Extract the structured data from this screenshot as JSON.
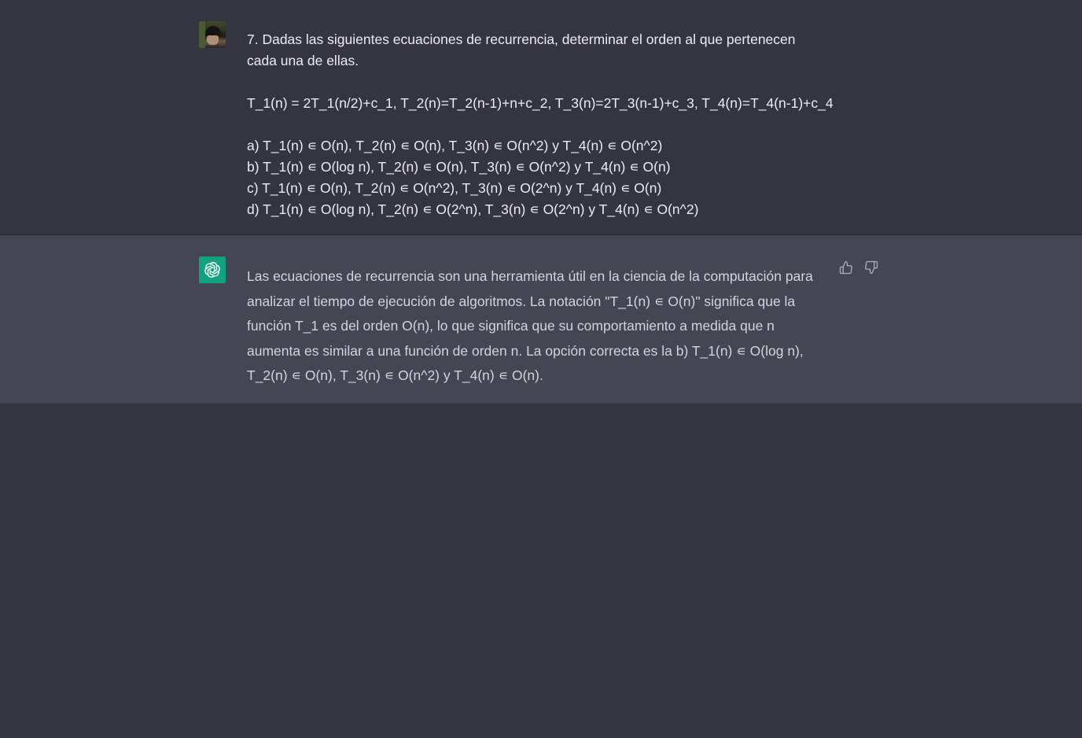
{
  "conversation": {
    "user_message": {
      "avatar": "user-photo-avatar",
      "lines": [
        "7. Dadas las siguientes ecuaciones de recurrencia, determinar el orden al que pertenecen",
        "cada una de ellas.",
        "T_1(n) = 2T_1(n/2)+c_1, T_2(n)=T_2(n-1)+n+c_2, T_3(n)=2T_3(n-1)+c_3, T_4(n)=T_4(n-1)+c_4",
        "a) T_1(n) ∊ O(n), T_2(n) ∊ O(n), T_3(n) ∊ O(n^2) y T_4(n) ∊ O(n^2)",
        "b) T_1(n) ∊ O(log n), T_2(n) ∊ O(n), T_3(n) ∊ O(n^2) y T_4(n) ∊ O(n)",
        "c) T_1(n) ∊ O(n), T_2(n) ∊ O(n^2), T_3(n) ∊ O(2^n) y T_4(n) ∊ O(n)",
        "d) T_1(n) ∊ O(log n), T_2(n) ∊ O(2^n), T_3(n) ∊ O(2^n) y T_4(n) ∊ O(n^2)"
      ]
    },
    "assistant_message": {
      "avatar": "openai-logo-icon",
      "text": "Las ecuaciones de recurrencia son una herramienta útil en la ciencia de la computación para analizar el tiempo de ejecución de algoritmos. La notación \"T_1(n) ∊ O(n)\" significa que la función T_1 es del orden O(n), lo que significa que su comportamiento a medida que n aumenta es similar a una función de orden n. La opción correcta es la b) T_1(n) ∊ O(log n), T_2(n) ∊ O(n), T_3(n) ∊ O(n^2) y T_4(n) ∊ O(n).",
      "feedback": {
        "thumbs_up_icon": "thumbs-up-icon",
        "thumbs_down_icon": "thumbs-down-icon"
      }
    }
  },
  "colors": {
    "background": "#343541",
    "assistant_background": "#444654",
    "brand_green": "#10a37f",
    "user_text": "#ececf1",
    "assistant_text": "#d1d5db"
  }
}
